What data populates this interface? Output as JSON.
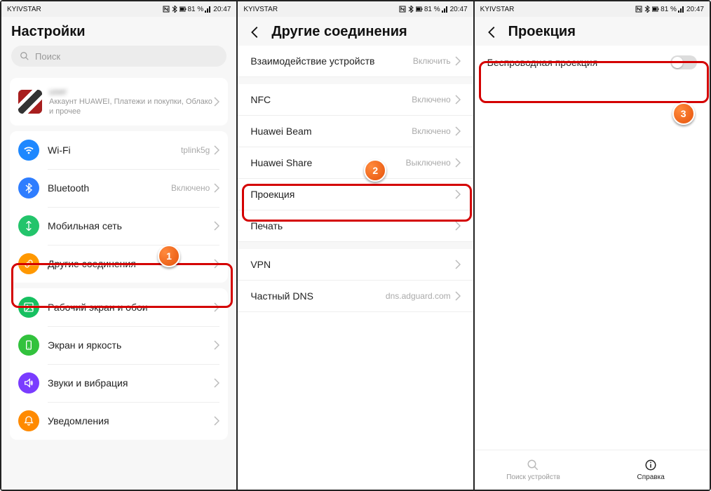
{
  "status": {
    "carrier": "KYIVSTAR",
    "battery": "81 %",
    "time": "20:47"
  },
  "panel1": {
    "title": "Настройки",
    "search_placeholder": "Поиск",
    "account": {
      "name": "user",
      "desc": "Аккаунт HUAWEI, Платежи и покупки, Облако и прочее"
    },
    "rows": [
      {
        "label": "Wi-Fi",
        "value": "tplink5g"
      },
      {
        "label": "Bluetooth",
        "value": "Включено"
      },
      {
        "label": "Мобильная сеть",
        "value": ""
      },
      {
        "label": "Другие соединения",
        "value": ""
      }
    ],
    "rows2": [
      {
        "label": "Рабочий экран и обои",
        "value": ""
      },
      {
        "label": "Экран и яркость",
        "value": ""
      },
      {
        "label": "Звуки и вибрация",
        "value": ""
      },
      {
        "label": "Уведомления",
        "value": ""
      }
    ]
  },
  "panel2": {
    "title": "Другие соединения",
    "rows": [
      {
        "label": "Взаимодействие устройств",
        "value": "Включить"
      },
      {
        "label": "NFC",
        "value": "Включено"
      },
      {
        "label": "Huawei Beam",
        "value": "Включено"
      },
      {
        "label": "Huawei Share",
        "value": "Выключено"
      },
      {
        "label": "Проекция",
        "value": ""
      },
      {
        "label": "Печать",
        "value": ""
      },
      {
        "label": "VPN",
        "value": ""
      },
      {
        "label": "Частный DNS",
        "value": "dns.adguard.com"
      }
    ]
  },
  "panel3": {
    "title": "Проекция",
    "toggle_label": "Беспроводная проекция",
    "bottom": {
      "search": "Поиск устройств",
      "help": "Справка"
    }
  },
  "annotations": {
    "b1": "1",
    "b2": "2",
    "b3": "3"
  }
}
